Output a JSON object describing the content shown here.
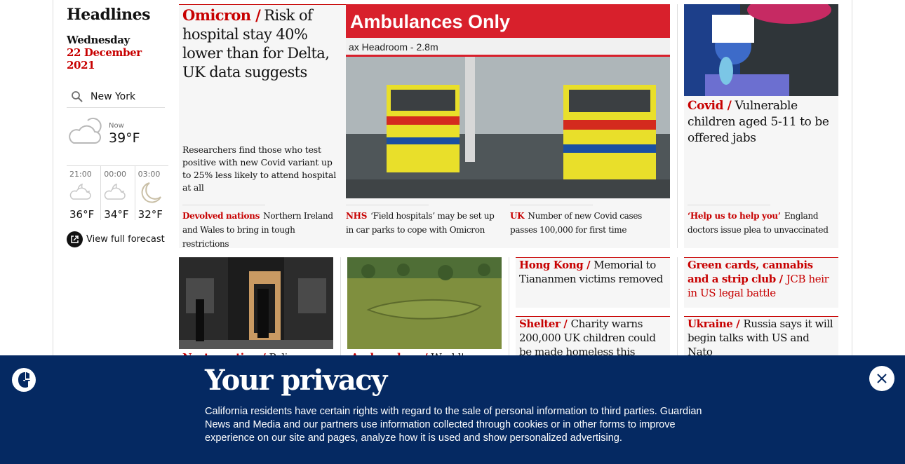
{
  "rail": {
    "title": "Headlines",
    "day": "Wednesday",
    "date": "22 December 2021"
  },
  "weather": {
    "location": "New York",
    "now_label": "Now",
    "now_temp": "39°F",
    "forecast": [
      {
        "time": "21:00",
        "temp": "36°F",
        "icon": "partly-cloudy-night-icon"
      },
      {
        "time": "00:00",
        "temp": "34°F",
        "icon": "partly-cloudy-night-icon"
      },
      {
        "time": "03:00",
        "temp": "32°F",
        "icon": "moon-icon"
      }
    ],
    "full_forecast": "View full forecast"
  },
  "lead": {
    "kicker": "Omicron /",
    "headline": "Risk of hospital stay 40% lower than for Delta, UK data suggests",
    "standfirst": "Researchers find those who test positive with new Covid variant up to 25% less likely to attend hospital at all",
    "image_sign_main": "Ambulances Only",
    "image_sign_sub": "ax Headroom - 2.8m"
  },
  "sublinks": [
    {
      "kicker": "Devolved nations",
      "text": "Northern Ireland and Wales to bring in tough restrictions"
    },
    {
      "kicker": "NHS",
      "text": "‘Field hospitals’ may be set up in car parks to cope with Omicron"
    },
    {
      "kicker": "UK",
      "text": "Number of new Covid cases passes 100,000 for first time"
    }
  ],
  "covid_card": {
    "kicker": "Covid /",
    "headline": "Vulnerable children aged 5-11 to be offered jabs",
    "sublink_kicker": "‘Help us to help you’",
    "sublink_text": "England doctors issue plea to unvaccinated"
  },
  "row2": {
    "card_a_kicker_partial": "Next meeting /",
    "card_a_headline_partial": "Police",
    "card_b_kicker_partial": "Archaeology /",
    "card_b_headline_partial": "World's",
    "hongkong": {
      "kicker": "Hong Kong /",
      "headline": "Memorial to Tiananmen victims removed"
    },
    "greencards": {
      "kicker": "Green cards, cannabis and a strip club /",
      "headline": "JCB heir in US legal battle"
    },
    "shelter": {
      "kicker": "Shelter /",
      "headline": "Charity warns 200,000 UK children could be made homeless this"
    },
    "ukraine": {
      "kicker": "Ukraine /",
      "headline": "Russia says it will begin talks with US and Nato"
    }
  },
  "banner": {
    "title": "Your privacy",
    "body": "California residents have certain rights with regard to the sale of personal information to third parties. Guardian News and Media and our partners use information collected through cookies or in other forms to improve experience on our site and pages, analyze how it is used and show personalized advertising.",
    "bg_color": "#052962"
  },
  "colors": {
    "accent": "#c70000",
    "card_bg": "#f6f6f6"
  }
}
